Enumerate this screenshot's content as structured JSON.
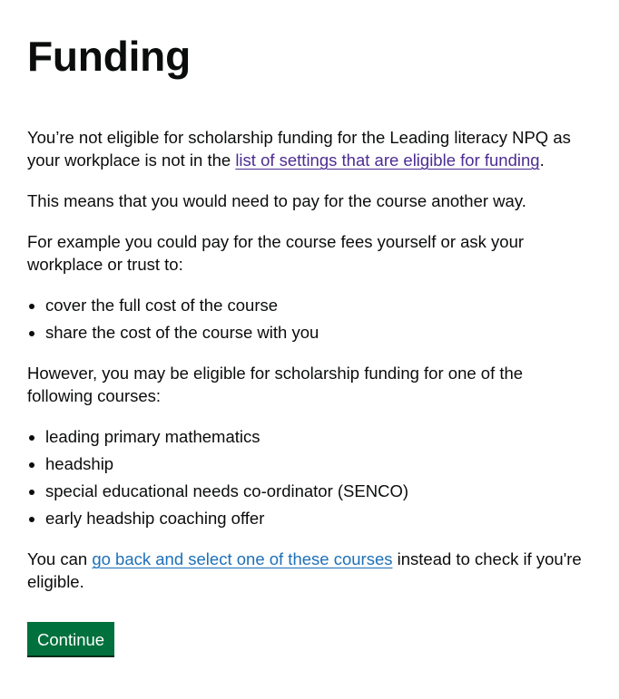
{
  "page": {
    "title": "Funding"
  },
  "intro": {
    "text_before_link": "You’re not eligible for scholarship funding for the Leading literacy NPQ as your workplace is not in the ",
    "link_text": "list of settings that are eligible for funding",
    "text_after_link": "."
  },
  "means": {
    "text": "This means that you would need to pay for the course another way."
  },
  "example": {
    "text": "For example you could pay for the course fees yourself or ask your workplace or trust to:"
  },
  "options_list": [
    "cover the full cost of the course",
    "share the cost of the course with you"
  ],
  "however": {
    "text": "However, you may be eligible for scholarship funding for one of the following courses:"
  },
  "courses_list": [
    "leading primary mathematics",
    "headship",
    "special educational needs co-ordinator (SENCO)",
    "early headship coaching offer"
  ],
  "go_back": {
    "text_before_link": "You can ",
    "link_text": "go back and select one of these courses",
    "text_after_link": " instead to check if you're eligible."
  },
  "actions": {
    "continue_label": "Continue",
    "button_color": "#00703c"
  },
  "colors": {
    "text": "#0b0c0c",
    "link": "#1d70b8",
    "visited_link": "#4c2c92"
  }
}
